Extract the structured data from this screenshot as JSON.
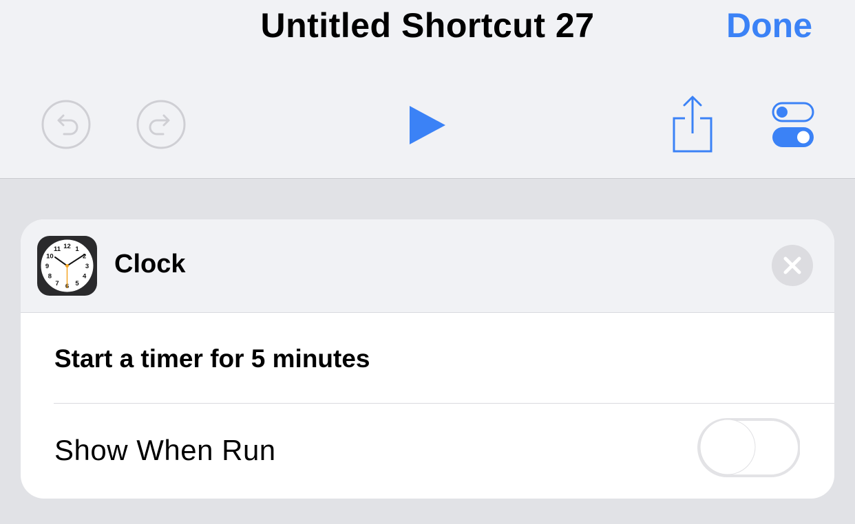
{
  "header": {
    "title": "Untitled Shortcut 27",
    "done_label": "Done"
  },
  "toolbar": {
    "undo_icon": "undo-icon",
    "redo_icon": "redo-icon",
    "play_icon": "play-icon",
    "share_icon": "share-icon",
    "settings_icon": "toggles-settings-icon"
  },
  "action": {
    "app_name": "Clock",
    "description": "Start a timer for 5 minutes",
    "show_when_run_label": "Show When Run",
    "show_when_run_on": false,
    "clock_numbers": [
      "12",
      "1",
      "2",
      "3",
      "4",
      "5",
      "6",
      "7",
      "8",
      "9",
      "10",
      "11"
    ]
  },
  "colors": {
    "accent": "#3b82f6",
    "disabled": "#cfcfd4",
    "header_bg": "#f1f2f5",
    "page_bg": "#e1e2e6"
  }
}
